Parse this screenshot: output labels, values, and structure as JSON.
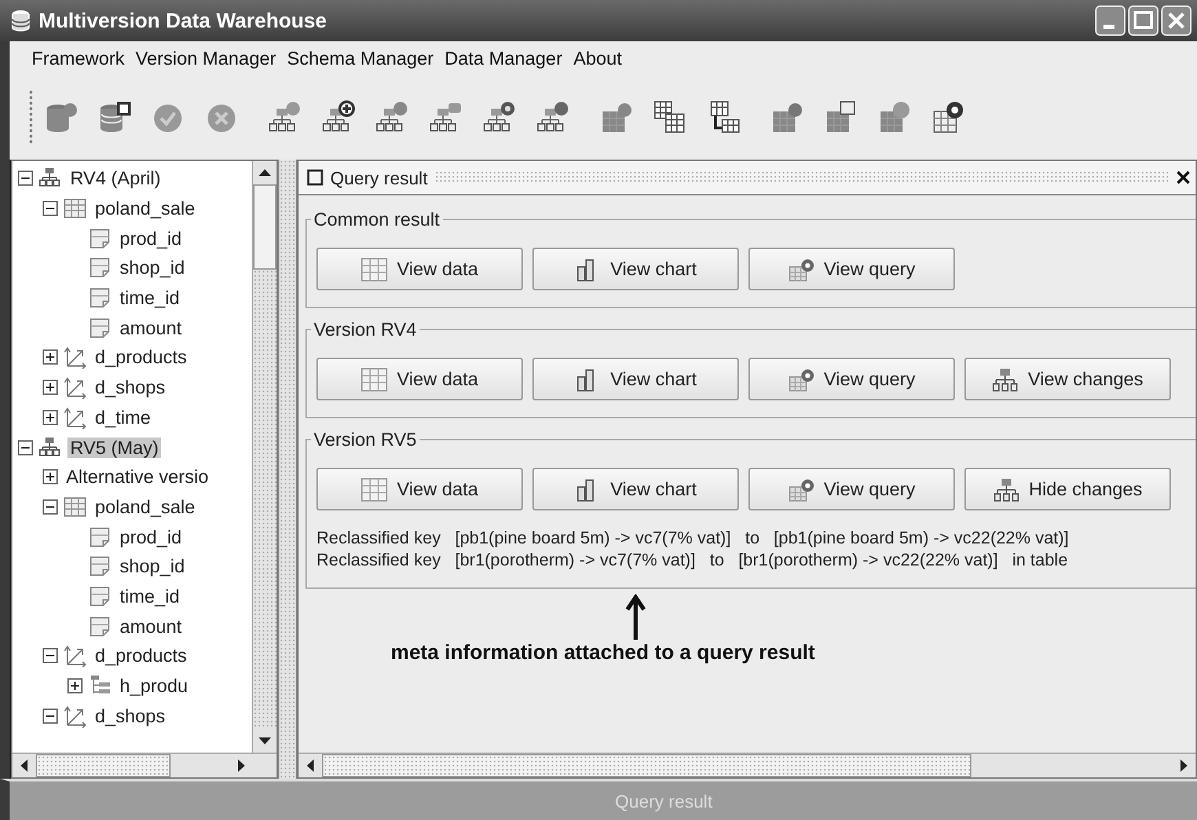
{
  "window": {
    "title": "Multiversion Data Warehouse"
  },
  "menu": [
    "Framework",
    "Version Manager",
    "Schema Manager",
    "Data Manager",
    "About"
  ],
  "tree": [
    {
      "label": "RV4 (April)",
      "kind": "version",
      "expanded": true,
      "selected": false,
      "children": [
        {
          "label": "poland_sale",
          "kind": "table",
          "expanded": true,
          "selected": false,
          "children": [
            {
              "label": "prod_id",
              "kind": "column",
              "selected": false
            },
            {
              "label": "shop_id",
              "kind": "column",
              "selected": false
            },
            {
              "label": "time_id",
              "kind": "column",
              "selected": false
            },
            {
              "label": "amount",
              "kind": "column",
              "selected": false
            }
          ]
        },
        {
          "label": "d_products",
          "kind": "dimension",
          "expanded": false,
          "selected": false
        },
        {
          "label": "d_shops",
          "kind": "dimension",
          "expanded": false,
          "selected": false
        },
        {
          "label": "d_time",
          "kind": "dimension",
          "expanded": false,
          "selected": false
        }
      ]
    },
    {
      "label": "RV5 (May)",
      "kind": "version",
      "expanded": true,
      "selected": true,
      "children": [
        {
          "label": "Alternative versio",
          "kind": "folder",
          "expanded": false,
          "selected": false
        },
        {
          "label": "poland_sale",
          "kind": "table",
          "expanded": true,
          "selected": false,
          "children": [
            {
              "label": "prod_id",
              "kind": "column",
              "selected": false
            },
            {
              "label": "shop_id",
              "kind": "column",
              "selected": false
            },
            {
              "label": "time_id",
              "kind": "column",
              "selected": false
            },
            {
              "label": "amount",
              "kind": "column",
              "selected": false
            }
          ]
        },
        {
          "label": "d_products",
          "kind": "dimension",
          "expanded": true,
          "selected": false,
          "children": [
            {
              "label": "h_produ",
              "kind": "hierarchy",
              "expanded": false,
              "selected": false
            }
          ]
        },
        {
          "label": "d_shops",
          "kind": "dimension",
          "expanded": true,
          "selected": false
        }
      ]
    }
  ],
  "result_panel": {
    "title": "Query result",
    "groups": [
      {
        "title": "Common result",
        "buttons": [
          {
            "label": "View data",
            "kind": "data"
          },
          {
            "label": "View chart",
            "kind": "chart"
          },
          {
            "label": "View query",
            "kind": "query"
          }
        ]
      },
      {
        "title": "Version RV4",
        "buttons": [
          {
            "label": "View data",
            "kind": "data"
          },
          {
            "label": "View chart",
            "kind": "chart"
          },
          {
            "label": "View query",
            "kind": "query"
          },
          {
            "label": "View changes",
            "kind": "changes"
          }
        ]
      },
      {
        "title": "Version RV5",
        "buttons": [
          {
            "label": "View data",
            "kind": "data"
          },
          {
            "label": "View chart",
            "kind": "chart"
          },
          {
            "label": "View query",
            "kind": "query"
          },
          {
            "label": "Hide changes",
            "kind": "changes"
          }
        ],
        "notes": [
          "Reclassified key   [pb1(pine board 5m) -> vc7(7% vat)]   to   [pb1(pine board 5m) -> vc22(22% vat)]",
          "Reclassified key   [br1(porotherm) -> vc7(7% vat)]   to   [br1(porotherm) -> vc22(22% vat)]   in table"
        ]
      }
    ]
  },
  "annotation": "meta information attached to a query result",
  "status_bar": "Query result"
}
